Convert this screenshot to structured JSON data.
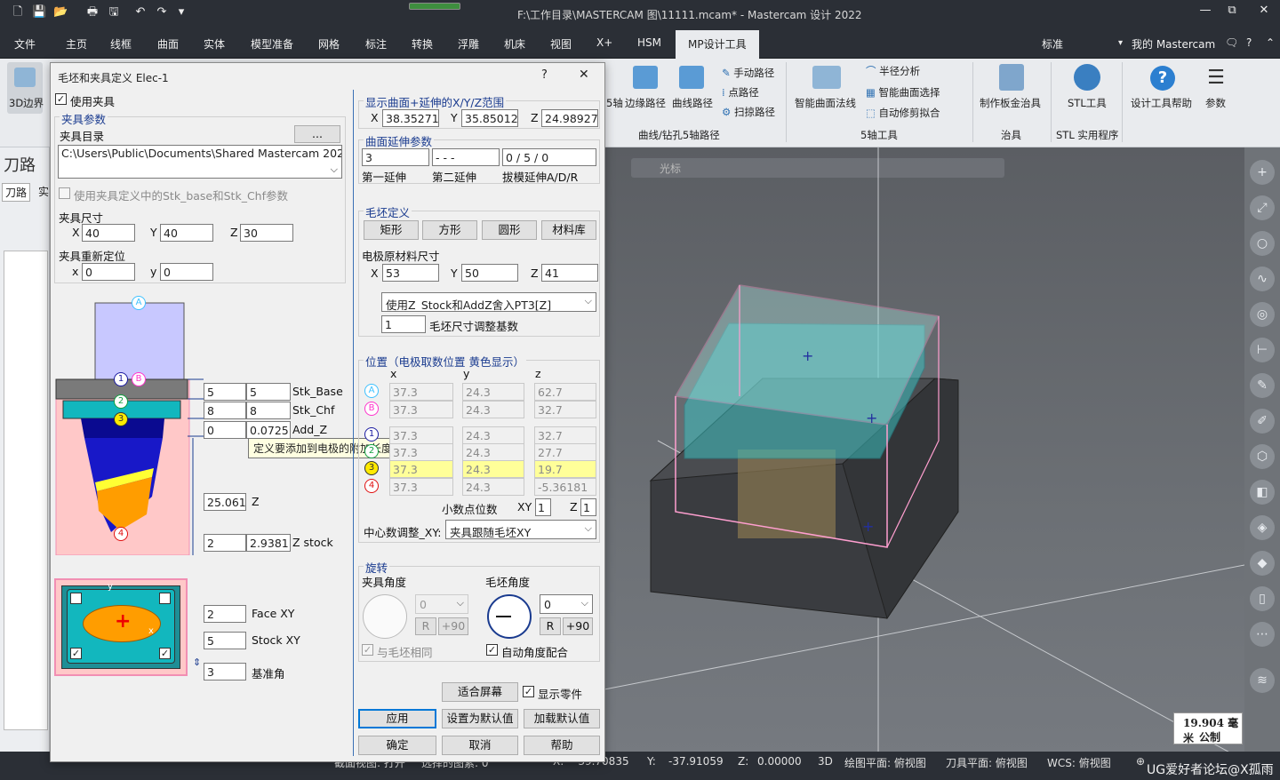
{
  "app": {
    "title": "F:\\工作目录\\MASTERCAM 图\\11111.mcam* - Mastercam 设计 2022",
    "window_controls": [
      "—",
      "⧉",
      "✕"
    ]
  },
  "menu": {
    "tabs": [
      "文件",
      "主页",
      "线框",
      "曲面",
      "实体",
      "模型准备",
      "网格",
      "标注",
      "转换",
      "浮雕",
      "机床",
      "视图",
      "X+",
      "HSM",
      "MP设计工具"
    ],
    "active": "MP设计工具",
    "right_label": "标准",
    "my_mastercam": "我的 Mastercam"
  },
  "ribbon": {
    "left_label": "3D边界",
    "items": {
      "manual_path": "手动路径",
      "point_path": "点路径",
      "sweep_path": "扫掠路径",
      "axis5": "5轴",
      "edge_path": "边缘路径",
      "curve_path": "曲线路径",
      "group_curve": "曲线/钻孔5轴路径",
      "smart_surface_normal": "智能曲面法线",
      "half_diameter": "半径分析",
      "smart_surface_select": "智能曲面选择",
      "auto_trim": "自动修剪拟合",
      "group_5axis": "5轴工具",
      "sheet_metal": "制作板金治具",
      "group_fixture": "治具",
      "stl_tool": "STL工具",
      "group_stl": "STL 实用程序",
      "design_help": "设计工具帮助",
      "params": "参数"
    }
  },
  "left_panel": {
    "title": "刀路",
    "tabs": [
      "刀路",
      "实"
    ]
  },
  "viewport": {
    "toolbar_label": "光标",
    "scale_value": "19.904 毫米",
    "scale_unit": "公制"
  },
  "status": {
    "section_view": "截面视图: 打开",
    "selected": "选择的图素: 0",
    "x_label": "X:",
    "x_val": "-39.70835",
    "y_label": "Y:",
    "y_val": "-37.91059",
    "z_label": "Z:",
    "z_val": "0.00000",
    "mode": "3D",
    "draw_plane": "绘图平面: 俯视图",
    "tool_plane": "刀具平面: 俯视图",
    "wcs": "WCS: 俯视图",
    "watermark": "UG爱好者论坛@X孤雨"
  },
  "dialog": {
    "title": "毛坯和夹具定义  Elec-1",
    "help": "?",
    "close": "✕",
    "use_fixture": "使用夹具",
    "fixture_params": "夹具参数",
    "fixture_dir_label": "夹具目录",
    "browse": "...",
    "fixture_dir": "C:\\Users\\Public\\Documents\\Shared Mastercam 2022",
    "use_stk_params": "使用夹具定义中的Stk_base和Stk_Chf参数",
    "fixture_size": "夹具尺寸",
    "fs_x": "40",
    "fs_y": "40",
    "fs_z": "30",
    "fixture_reloc": "夹具重新定位",
    "fr_x": "0",
    "fr_y": "0",
    "lbl_x": "X",
    "lbl_y": "Y",
    "lbl_z": "Z",
    "lbl_x_low": "x",
    "lbl_y_low": "y",
    "stk_base_a": "5",
    "stk_base_b": "5",
    "stk_base": "Stk_Base",
    "stk_chf_a": "8",
    "stk_chf_b": "8",
    "stk_chf": "Stk_Chf",
    "add_z_a": "0",
    "add_z_b": "0.0725",
    "add_z": "Add_Z",
    "tooltip": "定义要添加到电极的附加长度",
    "z_val": "25.061",
    "z_lbl": "Z",
    "zstock_a": "2",
    "zstock_b": "2.9381",
    "zstock": "Z stock",
    "face_xy_val": "2",
    "face_xy": "Face XY",
    "stock_xy_val": "5",
    "stock_xy": "Stock XY",
    "base_angle_val": "3",
    "base_angle": "基准角",
    "diagram_y": "y",
    "diagram_x": "x",
    "disp_range": "显示曲面+延伸的X/Y/Z范围",
    "dr_x": "38.35271",
    "dr_y": "35.85012",
    "dr_z": "24.98927",
    "surf_ext": "曲面延伸参数",
    "ext1": "3",
    "ext2": "- - -",
    "ext3": "0 / 5 / 0",
    "ext1_lbl": "第一延伸",
    "ext2_lbl": "第二延伸",
    "ext3_lbl": "拔模延伸A/D/R",
    "stock_def": "毛坯定义",
    "btn_rect": "矩形",
    "btn_square": "方形",
    "btn_round": "圆形",
    "btn_matlib": "材料库",
    "elec_size": "电极原材料尺寸",
    "es_x": "53",
    "es_y": "50",
    "es_z": "41",
    "z_mode": "使用Z_Stock和AddZ舍入PT3[Z]",
    "round_base_val": "1",
    "round_base": "毛坯尺寸调整基数",
    "position": "位置（电极取数位置 黄色显示）",
    "col_x": "x",
    "col_y": "y",
    "col_z": "z",
    "rows": [
      {
        "label": "A",
        "x": "37.3",
        "y": "24.3",
        "z": "62.7"
      },
      {
        "label": "B",
        "x": "37.3",
        "y": "24.3",
        "z": "32.7"
      },
      {
        "label": "1",
        "x": "37.3",
        "y": "24.3",
        "z": "32.7"
      },
      {
        "label": "2",
        "x": "37.3",
        "y": "24.3",
        "z": "27.7"
      },
      {
        "label": "3",
        "x": "37.3",
        "y": "24.3",
        "z": "19.7"
      },
      {
        "label": "4",
        "x": "37.3",
        "y": "24.3",
        "z": "-5.36181"
      }
    ],
    "decimals": "小数点位数",
    "dec_xy_lbl": "XY",
    "dec_xy": "1",
    "dec_z_lbl": "Z",
    "dec_z": "1",
    "center_adj": "中心数调整_XY:",
    "center_mode": "夹具跟随毛坯XY",
    "rotation": "旋转",
    "fixture_angle": "夹具角度",
    "stock_angle": "毛坯角度",
    "fa_val": "0",
    "sa_val": "0",
    "btn_r": "R",
    "btn_p90": "+90",
    "same_as_stock": "与毛坯相同",
    "auto_angle": "自动角度配合",
    "fit_screen": "适合屏幕",
    "show_parts": "显示零件",
    "apply": "应用",
    "set_default": "设置为默认值",
    "load_default": "加载默认值",
    "ok": "确定",
    "cancel": "取消",
    "help_btn": "帮助"
  }
}
